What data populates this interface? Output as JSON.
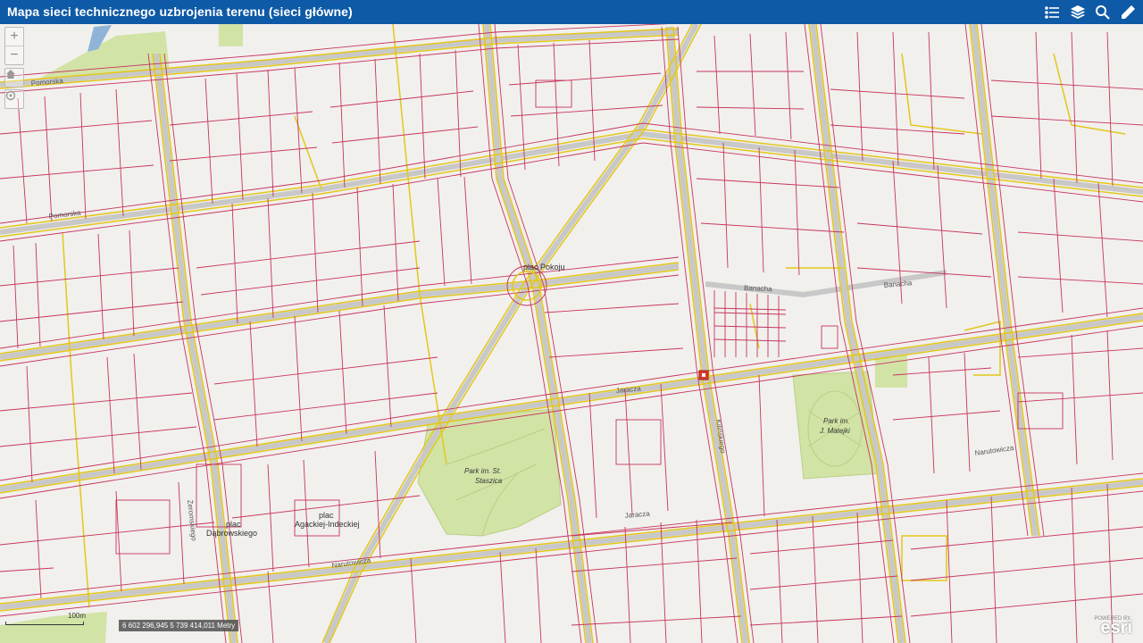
{
  "app": {
    "title": "Mapa sieci technicznego uzbrojenia terenu (sieci główne)"
  },
  "header_icons": [
    {
      "name": "legend-icon",
      "label": ""
    },
    {
      "name": "layers-icon",
      "label": ""
    },
    {
      "name": "search-icon",
      "label": ""
    },
    {
      "name": "measure-icon",
      "label": ""
    }
  ],
  "map_controls": {
    "zoom_in": "+",
    "zoom_out": "−",
    "home": "home-icon",
    "locate": "locate-icon"
  },
  "labels": {
    "plac_pokoju": "plac Pokoju",
    "banacha": "Banacha",
    "park_staszica_1": "Park im. St.",
    "park_staszica_2": "Staszica",
    "park_matejki_1": "Park im.",
    "park_matejki_2": "J. Matejki",
    "plac_dabrowskiego_1": "plac",
    "plac_dabrowskiego_2": "Dąbrowskiego",
    "plac_agackiej_1": "plac",
    "plac_agackiej_2": "Agackiej-Indeckiej",
    "narutowicza_1": "Narutowicza",
    "narutowicza_2": "Narutowicza",
    "pomorska": "Pomorska",
    "jaracza": "Jaracza",
    "zeromskiego": "Żeromskiego",
    "kilinskiego": "Kilińskiego"
  },
  "scale": {
    "label": "100m"
  },
  "coordinates": {
    "text": "6 602 296,945 5 739 414,011 Metry"
  },
  "attribution": {
    "logo": "esri",
    "powered": "POWERED BY"
  },
  "colors": {
    "header": "#0f5aa6",
    "parcel": "#c8345f",
    "utility": "#e3c71a",
    "road": "#c9c9c9",
    "park": "#d2e3a6"
  }
}
